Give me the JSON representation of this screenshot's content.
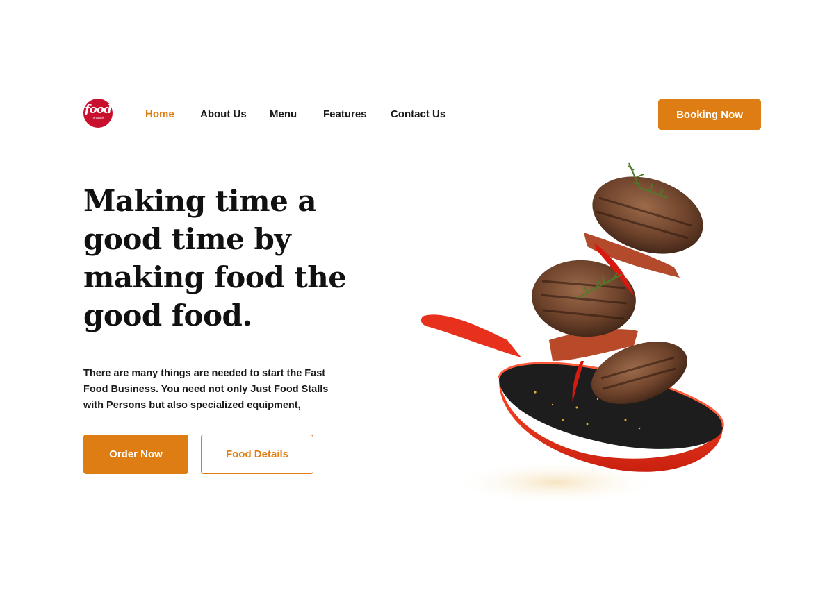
{
  "brand": {
    "logo_text": "food",
    "logo_subtext": "network"
  },
  "nav": {
    "items": [
      {
        "label": "Home",
        "active": true
      },
      {
        "label": "About Us",
        "active": false
      },
      {
        "label": "Menu",
        "active": false
      },
      {
        "label": "Features",
        "active": false
      },
      {
        "label": "Contact Us",
        "active": false
      }
    ],
    "booking_label": "Booking Now"
  },
  "hero": {
    "headline_lines": [
      "Making time a",
      "good time by",
      "making food the",
      "good food."
    ],
    "description_lines": [
      "There are many things are needed to start the Fast",
      "Food Business. You need not only Just Food Stalls",
      "with Persons but also specialized equipment,"
    ],
    "order_label": "Order Now",
    "details_label": "Food Details"
  },
  "colors": {
    "accent": "#dd7d13",
    "brand_red": "#c8102e",
    "pan_red": "#e8311c"
  }
}
